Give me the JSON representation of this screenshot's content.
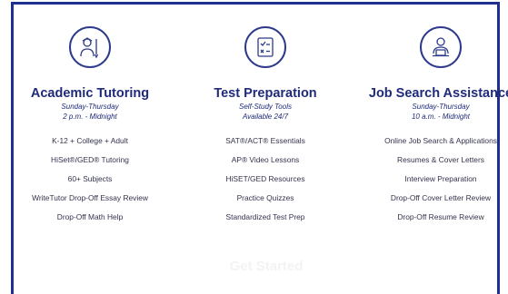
{
  "columns": [
    {
      "icon": "tutor-icon",
      "title": "Academic Tutoring",
      "hours_line1": "Sunday-Thursday",
      "hours_line2": "2 p.m. - Midnight",
      "items": [
        "K-12 + College + Adult",
        "HiSet®/GED® Tutoring",
        "60+ Subjects",
        "WriteTutor Drop-Off Essay Review",
        "Drop-Off Math Help"
      ]
    },
    {
      "icon": "test-document-icon",
      "title": "Test Preparation",
      "hours_line1": "Self-Study Tools",
      "hours_line2": "Available 24/7",
      "items": [
        "SAT®/ACT® Essentials",
        "AP® Video Lessons",
        "HiSET/GED Resources",
        "Practice Quizzes",
        "Standardized Test Prep"
      ]
    },
    {
      "icon": "job-seeker-icon",
      "title": "Job Search Assistance",
      "hours_line1": "Sunday-Thursday",
      "hours_line2": "10 a.m. - Midnight",
      "items": [
        "Online Job Search & Applications",
        "Resumes & Cover Letters",
        "Interview Preparation",
        "Drop-Off Cover Letter Review",
        "Drop-Off Resume Review"
      ]
    }
  ],
  "cta": {
    "label": "Get Started"
  },
  "colors": {
    "border": "#1f2f8f",
    "title": "#1f2a7a",
    "text": "#33334d",
    "cta": "#f3f3f6"
  }
}
